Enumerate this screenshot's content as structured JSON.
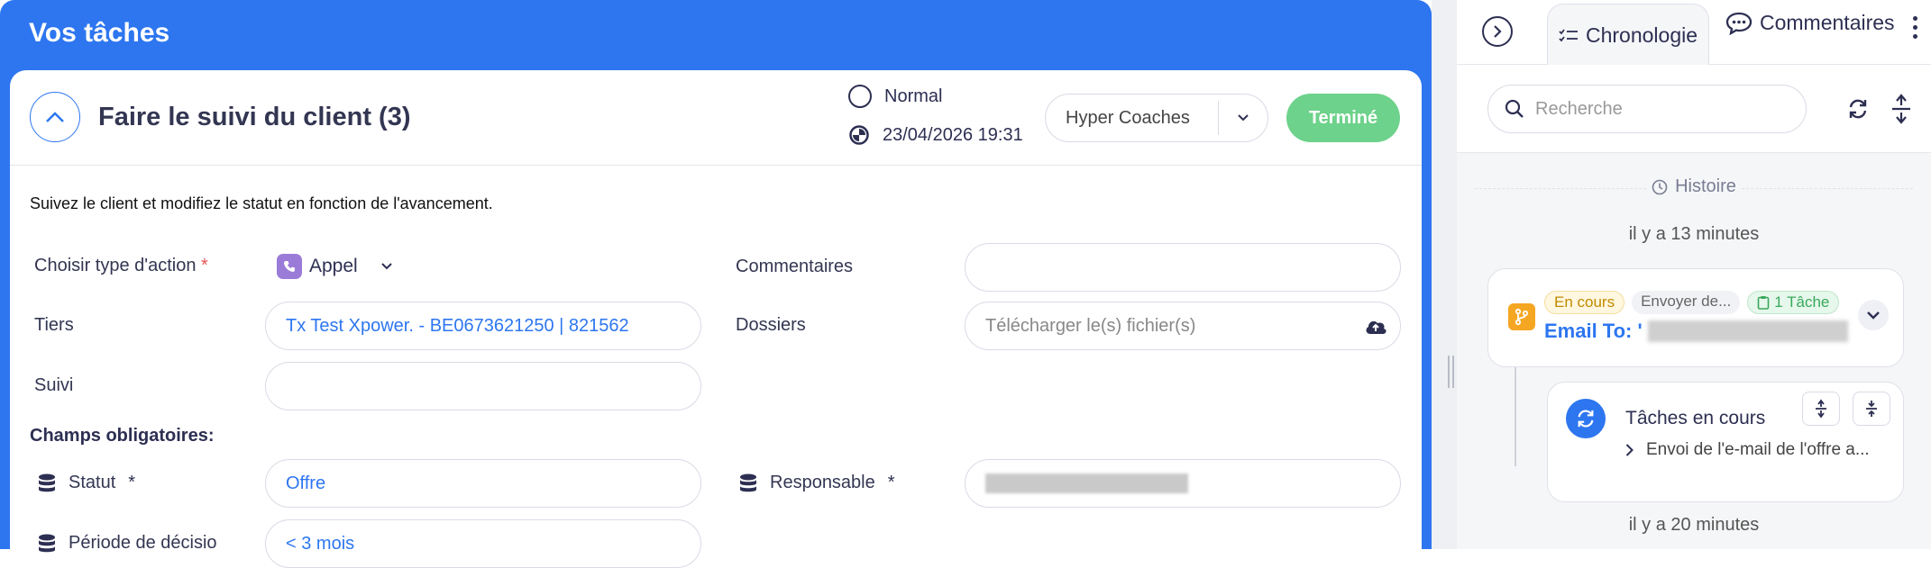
{
  "panel": {
    "title": "Vos tâches"
  },
  "task": {
    "title": "Faire le suivi du client (3)",
    "priority": "Normal",
    "due_date": "23/04/2026 19:31",
    "team": "Hyper Coaches",
    "done_label": "Terminé",
    "description": "Suivez le client et modifiez le statut en fonction de l'avancement."
  },
  "form": {
    "action_type_label": "Choisir type d'action",
    "action_type_value": "Appel",
    "tiers_label": "Tiers",
    "tiers_value": "Tx Test Xpower. - BE0673621250 | 821562",
    "suivi_label": "Suivi",
    "suivi_value": "",
    "required_section": "Champs obligatoires:",
    "statut_label": "Statut",
    "statut_value": "Offre",
    "periode_label": "Période de décisio",
    "periode_value": "< 3 mois",
    "comments_label": "Commentaires",
    "comments_value": "",
    "files_label": "Dossiers",
    "files_placeholder": "Télécharger le(s) fichier(s)",
    "responsable_label": "Responsable",
    "required_mark": "*"
  },
  "sidebar": {
    "tabs": [
      {
        "label": "Chronologie",
        "icon": "checklist-icon"
      },
      {
        "label": "Commentaires",
        "icon": "comment-icon"
      }
    ],
    "search_placeholder": "Recherche",
    "history_label": "Histoire",
    "events": [
      {
        "time_ago": "il y a 13 minutes",
        "badges": [
          "En cours",
          "Envoyer de...",
          "1 Tâche"
        ],
        "title_prefix": "Email To: '"
      }
    ],
    "subtask": {
      "title": "Tâches en cours",
      "item": "Envoi de l'e-mail de l'offre a..."
    },
    "next_time_ago": "il y a 20 minutes"
  },
  "colors": {
    "accent": "#2d76f0",
    "done": "#6dd28b",
    "warning": "#f5a623"
  }
}
